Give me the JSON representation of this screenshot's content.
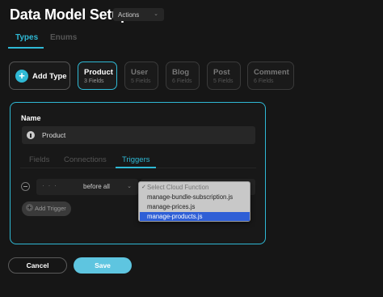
{
  "header": {
    "title": "Data Model Setup",
    "actions_label": "Actions"
  },
  "top_tabs": [
    {
      "label": "Types",
      "active": true
    },
    {
      "label": "Enums",
      "active": false
    }
  ],
  "types": {
    "add_label": "Add Type",
    "items": [
      {
        "name": "Product",
        "fields": "3 Fields",
        "active": true
      },
      {
        "name": "User",
        "fields": "5 Fields",
        "active": false
      },
      {
        "name": "Blog",
        "fields": "6 Fields",
        "active": false
      },
      {
        "name": "Post",
        "fields": "5 Fields",
        "active": false
      },
      {
        "name": "Comment",
        "fields": "6 Fields",
        "active": false
      }
    ]
  },
  "editor": {
    "name_label": "Name",
    "name_value": "Product",
    "sub_tabs": [
      {
        "label": "Fields",
        "active": false
      },
      {
        "label": "Connections",
        "active": false
      },
      {
        "label": "Triggers",
        "active": true
      }
    ],
    "trigger": {
      "timing_dots": "· · ·",
      "timing_value": "before all"
    },
    "add_trigger_label": "Add Trigger"
  },
  "function_dropdown": {
    "options": [
      {
        "label": "Select Cloud Function",
        "placeholder": true
      },
      {
        "label": "manage-bundle-subscription.js"
      },
      {
        "label": "manage-prices.js"
      },
      {
        "label": "manage-products.js",
        "selected": true
      }
    ]
  },
  "footer": {
    "cancel_label": "Cancel",
    "save_label": "Save"
  },
  "colors": {
    "accent": "#2fb9d5",
    "background": "#161616",
    "save_button": "#5ec5e0",
    "selected_option": "#2f5fd6"
  }
}
